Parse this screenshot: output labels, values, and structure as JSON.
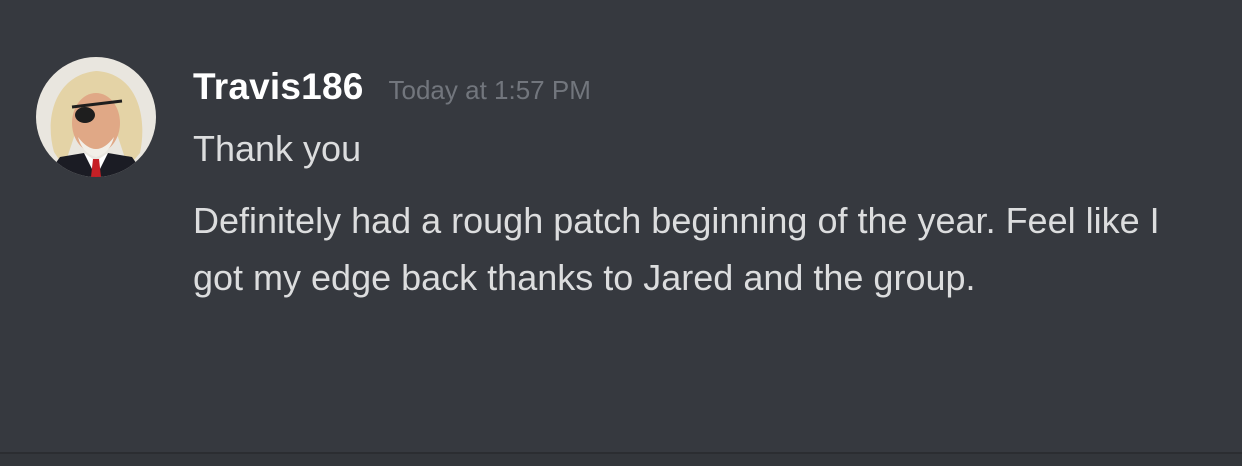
{
  "message": {
    "author": "Travis186",
    "timestamp": "Today at 1:57 PM",
    "lines": [
      "Thank you",
      "Definitely had a rough patch beginning of the year. Feel like I got my edge back thanks to Jared and the group."
    ],
    "avatar_icon": "user-avatar-eyepatch"
  },
  "colors": {
    "background": "#36393f",
    "username": "#ffffff",
    "timestamp": "#72767d",
    "message_text": "#dcddde"
  }
}
